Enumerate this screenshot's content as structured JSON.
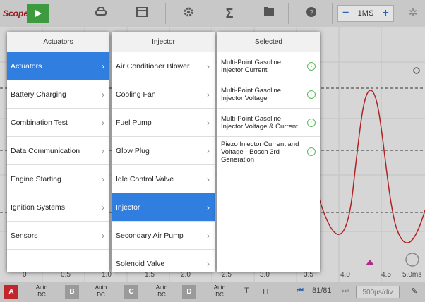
{
  "topbar": {
    "scope_label": "Scope",
    "timebase_value": "1MS",
    "icons": [
      "play-icon",
      "car-icon",
      "calendar-icon",
      "gear-icon",
      "sigma-icon",
      "folder-icon",
      "help-icon",
      "settings-icon"
    ]
  },
  "xaxis": {
    "ticks": [
      "0",
      "0.5",
      "1.0",
      "1.5",
      "2.0",
      "2.5",
      "3.0",
      "3.5",
      "4.0",
      "4.5",
      "5.0ms"
    ]
  },
  "bottombar": {
    "channels": [
      {
        "name": "A",
        "label": "Auto\nDC"
      },
      {
        "name": "B",
        "label": "Auto\nDC"
      },
      {
        "name": "C",
        "label": "Auto\nDC"
      },
      {
        "name": "D",
        "label": "Auto\nDC"
      }
    ],
    "trigger_label": "T",
    "frame_counter": "81/81",
    "sample_rate": "500µs/div"
  },
  "menus": {
    "actuators": {
      "header": "Actuators",
      "items": [
        "Actuators",
        "Battery Charging",
        "Combination Test",
        "Data Communication",
        "Engine Starting",
        "Ignition Systems",
        "Sensors",
        ""
      ],
      "selected": 0
    },
    "injector": {
      "header": "Injector",
      "items": [
        "Air Conditioner Blower",
        "Cooling Fan",
        "Fuel Pump",
        "Glow Plug",
        "Idle Control Valve",
        "Injector",
        "Secondary Air Pump",
        "Solenoid Valve"
      ],
      "selected": 5
    },
    "selected_panel": {
      "header": "Selected",
      "items": [
        "Multi-Point Gasoline Injector Current",
        "Multi-Point Gasoline Injector Voltage",
        "Multi-Point Gasoline Injector Voltage & Current",
        "Piezo Injector Current and Voltage - Bosch 3rd Generation"
      ]
    }
  },
  "colors": {
    "selected_row": "#2f7ee0",
    "waveform": "#b22222",
    "play_button": "#3e9a3e",
    "download_icon": "#5cb85c"
  }
}
